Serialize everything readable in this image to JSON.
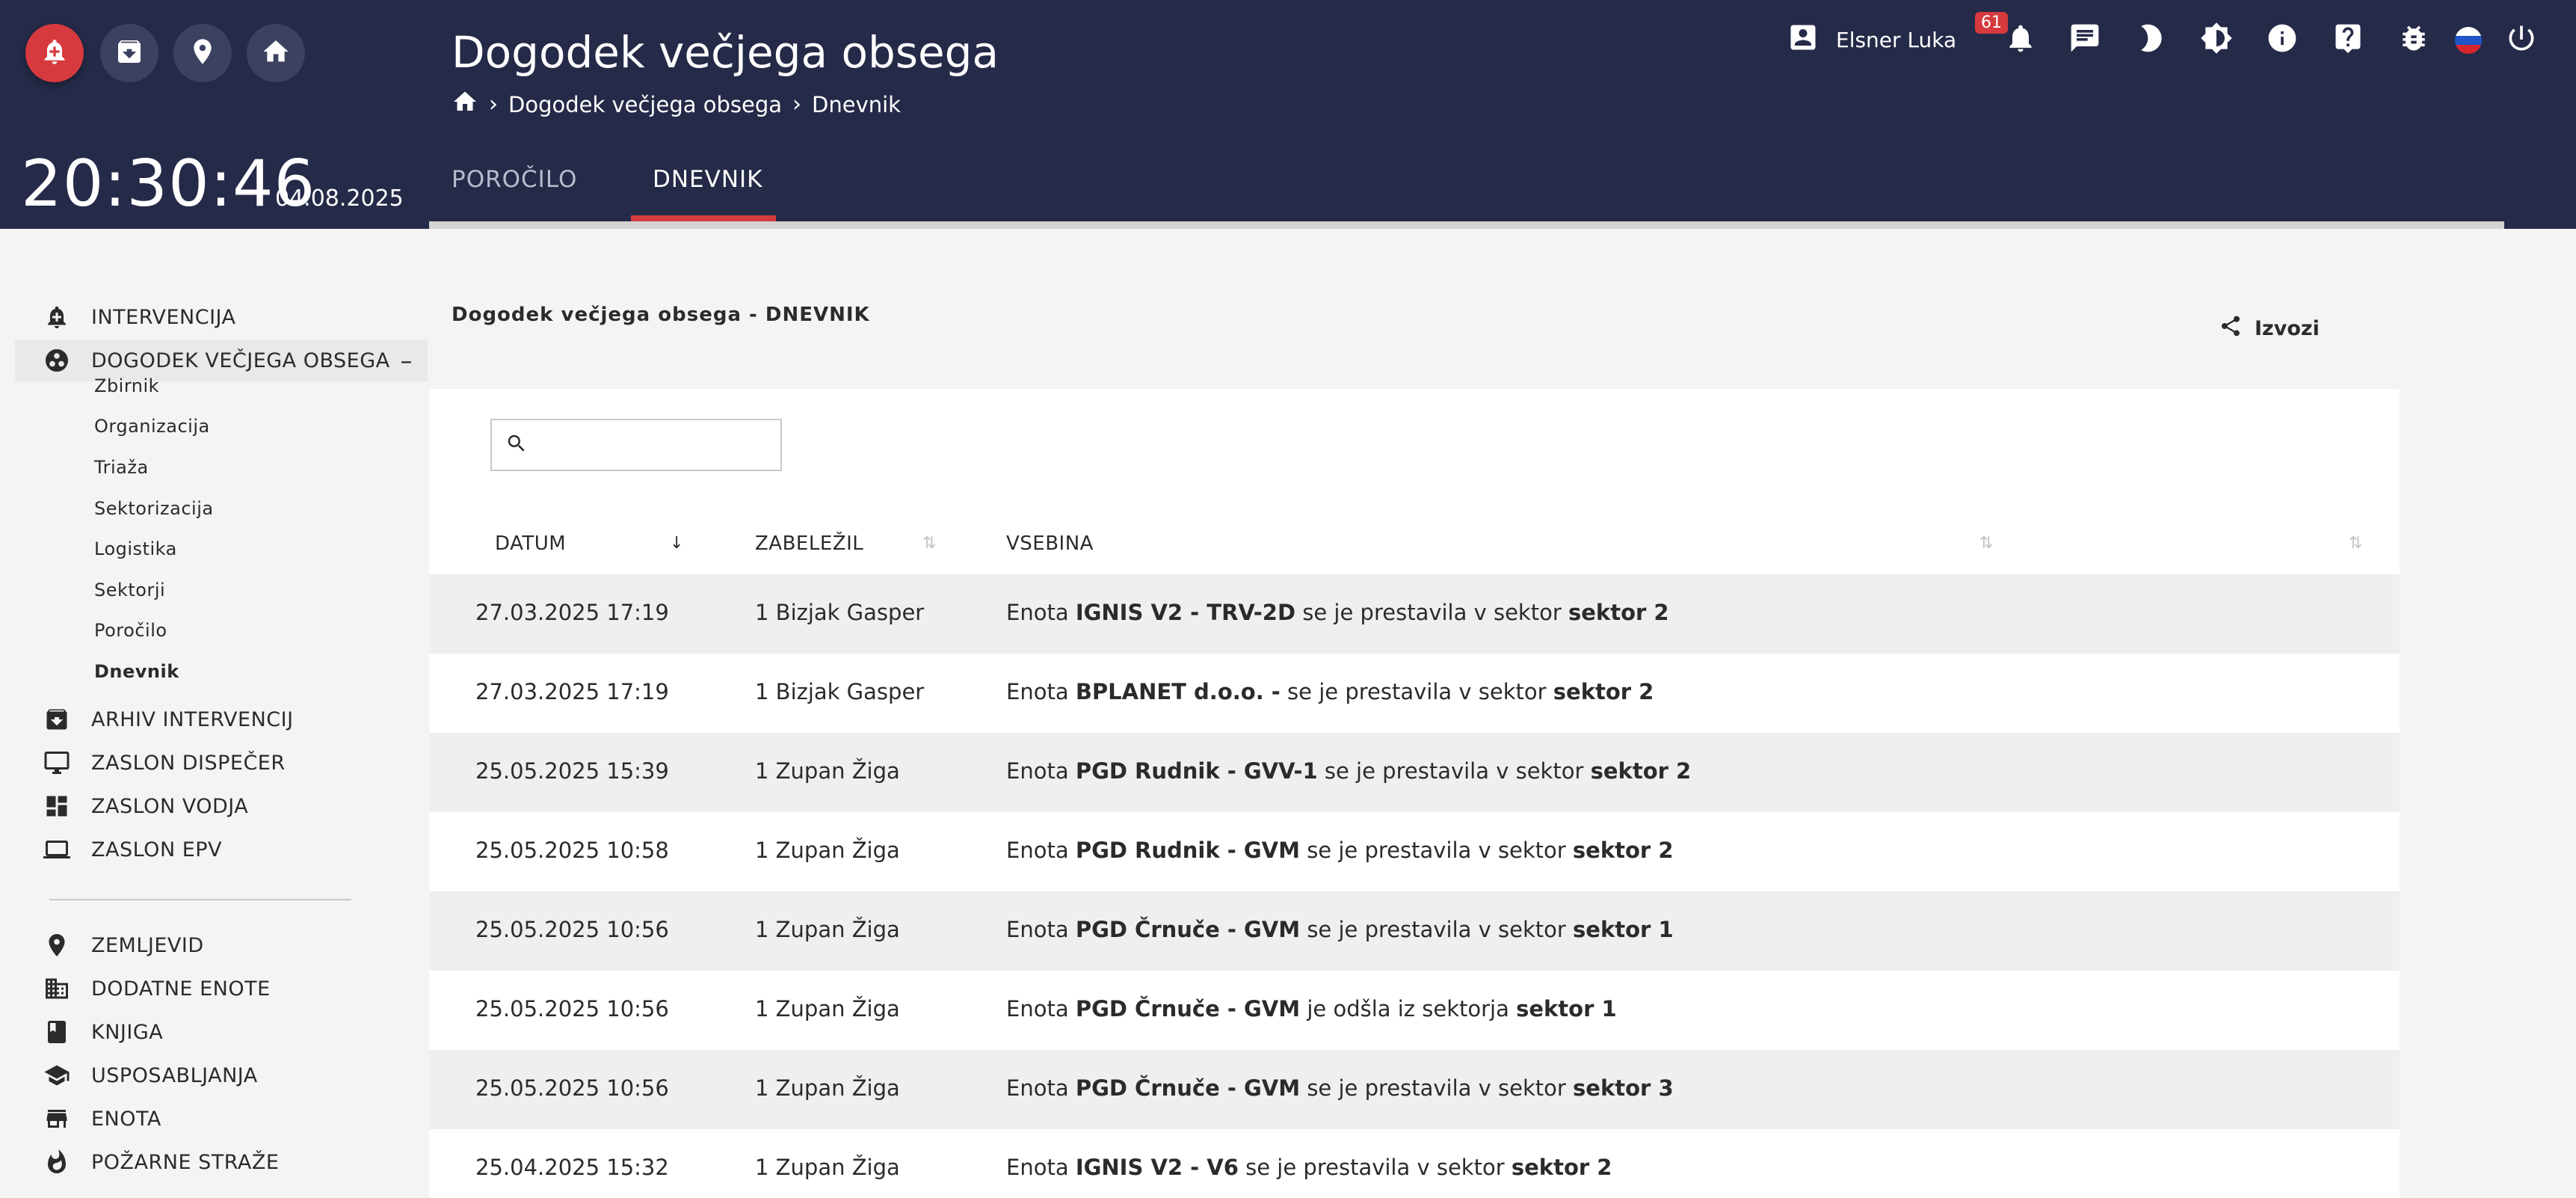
{
  "header": {
    "title": "Dogodek večjega obsega",
    "clock": "20:30:46",
    "date": "04.08.2025",
    "breadcrumb": [
      "Dogodek večjega obsega",
      "Dnevnik"
    ],
    "tabs": [
      {
        "label": "POROČILO",
        "active": false
      },
      {
        "label": "DNEVNIK",
        "active": true
      }
    ],
    "user_name": "Elsner Luka",
    "notification_count": "61",
    "icons": [
      "alarm-add-icon",
      "archive-icon",
      "location-pin-icon",
      "home-icon",
      "account-box-icon",
      "bell-icon",
      "chat-icon",
      "dark-mode-icon",
      "brightness-icon",
      "info-icon",
      "help-icon",
      "bug-icon",
      "slovenia-flag-icon",
      "power-icon"
    ]
  },
  "sidebar": {
    "items": [
      {
        "label": "INTERVENCIJA",
        "icon": "alarm-add-icon"
      },
      {
        "label": "DOGODEK VEČJEGA OBSEGA",
        "icon": "hub-icon",
        "expanded_marker": "–"
      },
      {
        "label": "ARHIV INTERVENCIJ",
        "icon": "archive-icon"
      },
      {
        "label": "ZASLON DISPEČER",
        "icon": "monitor-icon"
      },
      {
        "label": "ZASLON VODJA",
        "icon": "dashboard-icon"
      },
      {
        "label": "ZASLON EPV",
        "icon": "laptop-icon"
      },
      {
        "label": "ZEMLJEVID",
        "icon": "location-pin-icon"
      },
      {
        "label": "DODATNE ENOTE",
        "icon": "building-icon"
      },
      {
        "label": "KNJIGA",
        "icon": "book-icon"
      },
      {
        "label": "USPOSABLJANJA",
        "icon": "school-icon"
      },
      {
        "label": "ENOTA",
        "icon": "store-icon"
      },
      {
        "label": "POŽARNE STRAŽE",
        "icon": "fire-icon"
      }
    ],
    "subitems": [
      "Zbirnik",
      "Organizacija",
      "Triaža",
      "Sektorizacija",
      "Logistika",
      "Sektorji",
      "Poročilo",
      "Dnevnik"
    ],
    "active_subitem": "Dnevnik"
  },
  "main": {
    "section_title": "Dogodek večjega obsega - DNEVNIK",
    "export_label": "Izvozi",
    "search": {
      "value": "",
      "placeholder": ""
    },
    "columns": [
      "DATUM",
      "ZABELEŽIL",
      "VSEBINA"
    ],
    "rows": [
      {
        "date": "27.03.2025 17:19",
        "by": "1 Bizjak Gasper",
        "pre": "Enota ",
        "unit": "IGNIS V2 - TRV-2D",
        "mid": " se je prestavila v sektor ",
        "sector": "sektor 2"
      },
      {
        "date": "27.03.2025 17:19",
        "by": "1 Bizjak Gasper",
        "pre": "Enota ",
        "unit": "BPLANET d.o.o. -",
        "mid": " se je prestavila v sektor ",
        "sector": "sektor 2"
      },
      {
        "date": "25.05.2025 15:39",
        "by": "1 Zupan Žiga",
        "pre": "Enota ",
        "unit": "PGD Rudnik - GVV-1",
        "mid": " se je prestavila v sektor ",
        "sector": "sektor 2"
      },
      {
        "date": "25.05.2025 10:58",
        "by": "1 Zupan Žiga",
        "pre": "Enota ",
        "unit": "PGD Rudnik - GVM",
        "mid": " se je prestavila v sektor ",
        "sector": "sektor 2"
      },
      {
        "date": "25.05.2025 10:56",
        "by": "1 Zupan Žiga",
        "pre": "Enota ",
        "unit": "PGD Črnuče - GVM",
        "mid": " se je prestavila v sektor ",
        "sector": "sektor 1"
      },
      {
        "date": "25.05.2025 10:56",
        "by": "1 Zupan Žiga",
        "pre": "Enota ",
        "unit": "PGD Črnuče - GVM",
        "mid": " je odšla iz sektorja ",
        "sector": "sektor 1"
      },
      {
        "date": "25.05.2025 10:56",
        "by": "1 Zupan Žiga",
        "pre": "Enota ",
        "unit": "PGD Črnuče - GVM",
        "mid": " se je prestavila v sektor ",
        "sector": "sektor 3"
      },
      {
        "date": "25.04.2025 15:32",
        "by": "1 Zupan Žiga",
        "pre": "Enota ",
        "unit": "IGNIS V2 - V6",
        "mid": " se je prestavila v sektor ",
        "sector": "sektor 2"
      }
    ]
  },
  "colors": {
    "header_bg": "#252a48",
    "accent": "#d63a3f",
    "row_shade": "#efefef"
  }
}
